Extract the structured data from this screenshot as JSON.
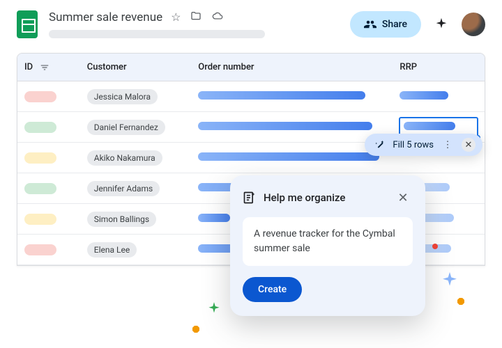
{
  "header": {
    "doc_title": "Summer sale revenue",
    "share_label": "Share"
  },
  "table": {
    "columns": {
      "id": "ID",
      "customer": "Customer",
      "order": "Order number",
      "rrp": "RRP"
    },
    "rows": [
      {
        "id_color": "#fad2cf",
        "customer": "Jessica Malora",
        "order_w": 240,
        "rrp_w": 70,
        "rrp_faded": false
      },
      {
        "id_color": "#ceead6",
        "customer": "Daniel Fernandez",
        "order_w": 250,
        "rrp_w": 74,
        "rrp_faded": false,
        "selected_rrp": true
      },
      {
        "id_color": "#feefc3",
        "customer": "Akiko Nakamura",
        "order_w": 260,
        "rrp_w": 0,
        "rrp_faded": true
      },
      {
        "id_color": "#ceead6",
        "customer": "Jennifer Adams",
        "order_w": 260,
        "rrp_w": 72,
        "rrp_faded": true
      },
      {
        "id_color": "#feefc3",
        "customer": "Simon Ballings",
        "order_w": 46,
        "rrp_w": 78,
        "rrp_faded": true
      },
      {
        "id_color": "#fad2cf",
        "customer": "Elena Lee",
        "order_w": 108,
        "rrp_w": 74,
        "rrp_faded": true
      }
    ]
  },
  "fill_chip": {
    "label": "Fill 5 rows"
  },
  "organize_card": {
    "title": "Help me organize",
    "prompt": "A revenue tracker for the Cymbal summer sale",
    "cta": "Create"
  }
}
